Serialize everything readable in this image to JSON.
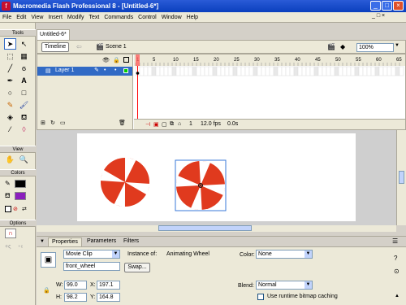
{
  "window": {
    "title": "Macromedia Flash Professional 8 - [Untitled-6*]"
  },
  "menu": [
    "File",
    "Edit",
    "View",
    "Insert",
    "Modify",
    "Text",
    "Commands",
    "Control",
    "Window",
    "Help"
  ],
  "tools": {
    "header": "Tools",
    "view_header": "View",
    "colors_header": "Colors",
    "options_header": "Options"
  },
  "document": {
    "tab": "Untitled-6*",
    "timeline_button": "Timeline",
    "scene": "Scene 1",
    "zoom": "100%"
  },
  "timeline": {
    "layer_name": "Layer 1",
    "frame_marks": [
      "1",
      "5",
      "10",
      "15",
      "20",
      "25",
      "30",
      "35",
      "40",
      "45",
      "50",
      "55",
      "60",
      "65"
    ],
    "current_frame": "1",
    "fps": "12.0 fps",
    "time": "0.0s"
  },
  "properties": {
    "tabs": [
      "Properties",
      "Parameters",
      "Filters"
    ],
    "symbol_type": "Movie Clip",
    "instance_name": "front_wheel",
    "instance_of_label": "Instance of:",
    "instance_of_value": "Animating Wheel",
    "swap_button": "Swap...",
    "color_label": "Color:",
    "color_value": "None",
    "w_label": "W:",
    "w": "99.0",
    "x_label": "X:",
    "x": "197.1",
    "h_label": "H:",
    "h": "98.2",
    "y_label": "Y:",
    "y": "164.8",
    "blend_label": "Blend:",
    "blend_value": "Normal",
    "bitmap_cache_label": "Use runtime bitmap caching"
  },
  "colors": {
    "accent": "#316ac5",
    "wheel_red": "#e03a1e",
    "titlebar": "#0a3fbd"
  }
}
